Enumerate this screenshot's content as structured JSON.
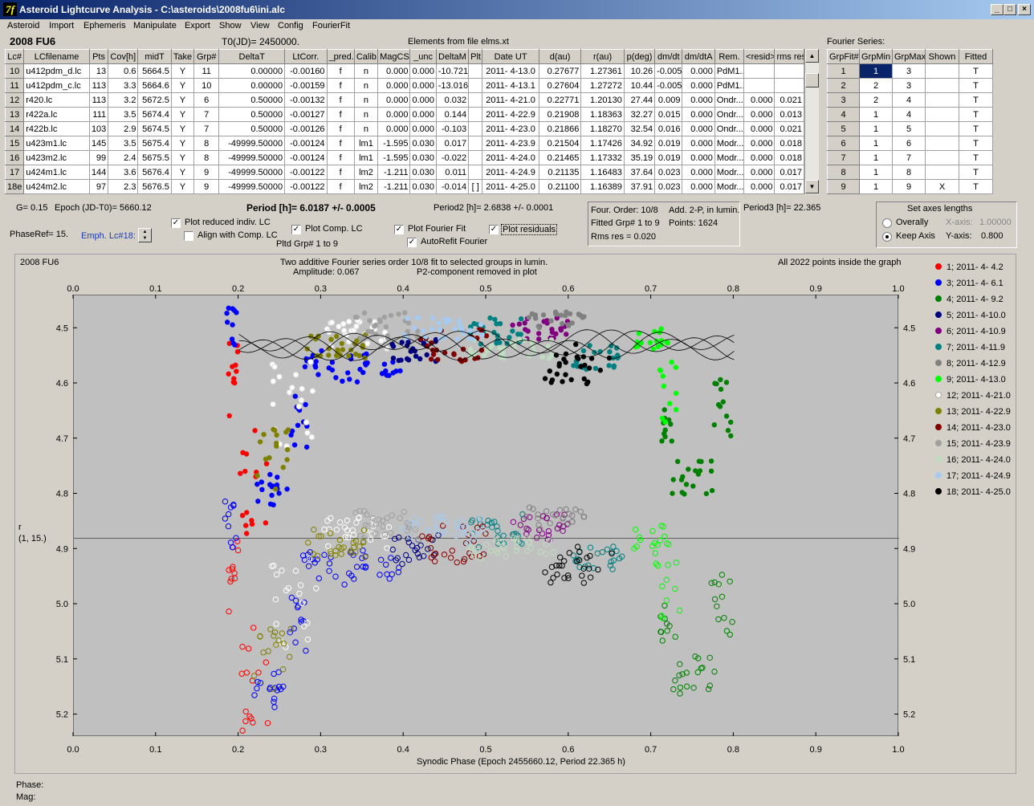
{
  "window": {
    "title": "Asteroid Lightcurve Analysis - C:\\asteroids\\2008fu6\\ini.alc",
    "icon": "7f",
    "min": "_",
    "max": "□",
    "close": "×"
  },
  "menu": [
    "Asteroid",
    "Import",
    "Ephemeris",
    "Manipulate",
    "Export",
    "Show",
    "View",
    "Config",
    "FourierFit"
  ],
  "header": {
    "object": "2008 FU6",
    "t0": "T0(JD)= 2450000.",
    "elements": "Elements from file elms.xt",
    "fourier_title": "Fourier Series:"
  },
  "lc_table": {
    "columns": [
      "Lc#",
      "LCfilename",
      "Pts",
      "Cov[h]",
      "midT",
      "Take",
      "Grp#",
      "DeltaT",
      "LtCorr.",
      "_pred.",
      "Calib.",
      "MagCS",
      "_unc",
      "DeltaM",
      "Plt",
      "Date UT",
      "d(au)",
      "r(au)",
      "p(deg)",
      "dm/dt",
      "dm/dtA",
      "Rem.",
      "<resid>",
      "rms res"
    ],
    "rows": [
      [
        "10",
        "u412pdm_d.lc",
        "13",
        "0.6",
        "5664.5",
        "Y",
        "11",
        "0.00000",
        "-0.00160",
        "f",
        "n",
        "0.000",
        "0.000",
        "-10.721",
        "",
        "2011- 4-13.0",
        "0.27677",
        "1.27361",
        "10.26",
        "-0.005",
        "0.000",
        "PdM1..",
        "",
        ""
      ],
      [
        "11",
        "u412pdm_c.lc",
        "113",
        "3.3",
        "5664.6",
        "Y",
        "10",
        "0.00000",
        "-0.00159",
        "f",
        "n",
        "0.000",
        "0.000",
        "-13.016",
        "",
        "2011- 4-13.1",
        "0.27604",
        "1.27272",
        "10.44",
        "-0.005",
        "0.000",
        "PdM1..",
        "",
        ""
      ],
      [
        "12",
        "r420.lc",
        "113",
        "3.2",
        "5672.5",
        "Y",
        "6",
        "0.50000",
        "-0.00132",
        "f",
        "n",
        "0.000",
        "0.000",
        "0.032",
        "",
        "2011- 4-21.0",
        "0.22771",
        "1.20130",
        "27.44",
        "0.009",
        "0.000",
        "Ondr...",
        "0.000",
        "0.021"
      ],
      [
        "13",
        "r422a.lc",
        "111",
        "3.5",
        "5674.4",
        "Y",
        "7",
        "0.50000",
        "-0.00127",
        "f",
        "n",
        "0.000",
        "0.000",
        "0.144",
        "",
        "2011- 4-22.9",
        "0.21908",
        "1.18363",
        "32.27",
        "0.015",
        "0.000",
        "Ondr...",
        "0.000",
        "0.013"
      ],
      [
        "14",
        "r422b.lc",
        "103",
        "2.9",
        "5674.5",
        "Y",
        "7",
        "0.50000",
        "-0.00126",
        "f",
        "n",
        "0.000",
        "0.000",
        "-0.103",
        "",
        "2011- 4-23.0",
        "0.21866",
        "1.18270",
        "32.54",
        "0.016",
        "0.000",
        "Ondr...",
        "0.000",
        "0.021"
      ],
      [
        "15",
        "u423m1.lc",
        "145",
        "3.5",
        "5675.4",
        "Y",
        "8",
        "-49999.50000",
        "-0.00124",
        "f",
        "lm1",
        "-1.595",
        "0.030",
        "0.017",
        "",
        "2011- 4-23.9",
        "0.21504",
        "1.17426",
        "34.92",
        "0.019",
        "0.000",
        "Modr...",
        "0.000",
        "0.018"
      ],
      [
        "16",
        "u423m2.lc",
        "99",
        "2.4",
        "5675.5",
        "Y",
        "8",
        "-49999.50000",
        "-0.00124",
        "f",
        "lm1",
        "-1.595",
        "0.030",
        "-0.022",
        "",
        "2011- 4-24.0",
        "0.21465",
        "1.17332",
        "35.19",
        "0.019",
        "0.000",
        "Modr...",
        "0.000",
        "0.018"
      ],
      [
        "17",
        "u424m1.lc",
        "144",
        "3.6",
        "5676.4",
        "Y",
        "9",
        "-49999.50000",
        "-0.00122",
        "f",
        "lm2",
        "-1.211",
        "0.030",
        "0.011",
        "",
        "2011- 4-24.9",
        "0.21135",
        "1.16483",
        "37.64",
        "0.023",
        "0.000",
        "Modr...",
        "0.000",
        "0.017"
      ],
      [
        "18e",
        "u424m2.lc",
        "97",
        "2.3",
        "5676.5",
        "Y",
        "9",
        "-49999.50000",
        "-0.00122",
        "f",
        "lm2",
        "-1.211",
        "0.030",
        "-0.014",
        "[ ]",
        "2011- 4-25.0",
        "0.21100",
        "1.16389",
        "37.91",
        "0.023",
        "0.000",
        "Modr...",
        "0.000",
        "0.017"
      ]
    ]
  },
  "fourier_table": {
    "columns": [
      "GrpFit#",
      "GrpMin",
      "GrpMax",
      "Shown",
      "Fitted"
    ],
    "rows": [
      [
        "1",
        "1",
        "3",
        "",
        "T"
      ],
      [
        "2",
        "2",
        "3",
        "",
        "T"
      ],
      [
        "3",
        "2",
        "4",
        "",
        "T"
      ],
      [
        "4",
        "1",
        "4",
        "",
        "T"
      ],
      [
        "5",
        "1",
        "5",
        "",
        "T"
      ],
      [
        "6",
        "1",
        "6",
        "",
        "T"
      ],
      [
        "7",
        "1",
        "7",
        "",
        "T"
      ],
      [
        "8",
        "1",
        "8",
        "",
        "T"
      ],
      [
        "9",
        "1",
        "9",
        "X",
        "T"
      ]
    ]
  },
  "controls": {
    "g": "G= 0.15",
    "epoch": "Epoch (JD-T0)= 5660.12",
    "phaseref": "PhaseRef= 15.",
    "emph": "Emph. Lc#18:",
    "plot_reduced": "Plot reduced indiv. LC",
    "align": "Align with Comp. LC",
    "plot_comp": "Plot Comp. LC",
    "pltd_grp": "Pltd Grp#  1   to   9",
    "plot_fourier": "Plot Fourier Fit",
    "autorefit": "AutoRefit Fourier",
    "plot_residuals": "Plot residuals",
    "period": "Period [h]= 6.0187 +/- 0.0005",
    "period2": "Period2 [h]= 2.6838 +/- 0.0001",
    "period3": "Period3 [h]= 22.365",
    "four_order": "Four. Order: 10/8",
    "add": "Add. 2-P, in lumin.",
    "fitted_grp": "Fitted Grp# 1 to 9",
    "points": "Points: 1624",
    "rms": "Rms res     = 0.020",
    "axes_title": "Set axes lengths",
    "overally": "Overally",
    "keep_axis": "Keep Axis",
    "xaxis_lbl": "X-axis:",
    "xaxis_val": "1.00000",
    "yaxis_lbl": "Y-axis:",
    "yaxis_val": "0.800",
    "phase_lbl": "Phase:",
    "mag_lbl": "Mag:"
  },
  "chart_data": {
    "type": "scatter",
    "object": "2008 FU6",
    "title": "Two additive Fourier series order 10/8 fit to selected groups in lumin.",
    "subtitle": "Amplitude: 0.067",
    "subtitle2": "P2-component removed in plot",
    "note": "All 2022 points inside the graph",
    "xlabel": "Synodic Phase (Epoch 2455660.12, Period 22.365 h)",
    "ylabel": "r",
    "ylabel2": "(1, 15.)",
    "xlim": [
      0.0,
      1.0
    ],
    "ylim": [
      4.44,
      5.24
    ],
    "yticks": [
      "4.5",
      "4.6",
      "4.7",
      "4.8",
      "4.9",
      "5.0",
      "5.1",
      "5.2"
    ],
    "xticks": [
      "0.0",
      "0.1",
      "0.2",
      "0.3",
      "0.4",
      "0.5",
      "0.6",
      "0.7",
      "0.8",
      "0.9",
      "1.0"
    ],
    "y_inverted": true,
    "residual_offset": 0.36,
    "ref_line": 4.88,
    "series": [
      {
        "name": "1; 2011- 4- 4.2",
        "color": "#ff0000",
        "segments": [
          [
            0.185,
            0.205,
            4.52,
            4.66
          ],
          [
            0.2,
            0.235,
            4.68,
            4.88
          ]
        ]
      },
      {
        "name": "3; 2011- 4- 6.1",
        "color": "#0000ff",
        "segments": [
          [
            0.185,
            0.2,
            4.46,
            4.54
          ],
          [
            0.22,
            0.26,
            4.76,
            4.82
          ],
          [
            0.26,
            0.285,
            4.62,
            4.72
          ],
          [
            0.28,
            0.4,
            4.54,
            4.6
          ]
        ]
      },
      {
        "name": "4; 2011- 4- 9.2",
        "color": "#008000",
        "segments": [
          [
            0.71,
            0.725,
            4.64,
            4.72
          ],
          [
            0.725,
            0.775,
            4.74,
            4.8
          ],
          [
            0.775,
            0.8,
            4.58,
            4.7
          ]
        ]
      },
      {
        "name": "5; 2011- 4-10.0",
        "color": "#000080",
        "segments": [
          [
            0.38,
            0.44,
            4.52,
            4.56
          ]
        ]
      },
      {
        "name": "6; 2011- 4-10.9",
        "color": "#800080",
        "segments": [
          [
            0.53,
            0.6,
            4.48,
            4.52
          ]
        ]
      },
      {
        "name": "7; 2011- 4-11.9",
        "color": "#008080",
        "segments": [
          [
            0.48,
            0.55,
            4.48,
            4.53
          ],
          [
            0.6,
            0.66,
            4.53,
            4.58
          ]
        ]
      },
      {
        "name": "8; 2011- 4-12.9",
        "color": "#808080",
        "segments": [
          [
            0.55,
            0.62,
            4.47,
            4.5
          ]
        ]
      },
      {
        "name": "9; 2011- 4-13.0",
        "color": "#00ff00",
        "segments": [
          [
            0.68,
            0.72,
            4.5,
            4.54
          ],
          [
            0.71,
            0.73,
            4.55,
            4.68
          ]
        ]
      },
      {
        "name": "12; 2011- 4-21.0",
        "color": "#ffffff",
        "segments": [
          [
            0.24,
            0.29,
            4.56,
            4.72
          ],
          [
            0.3,
            0.38,
            4.48,
            4.54
          ]
        ]
      },
      {
        "name": "13; 2011- 4-22.9",
        "color": "#808000",
        "segments": [
          [
            0.22,
            0.26,
            4.68,
            4.8
          ],
          [
            0.28,
            0.36,
            4.51,
            4.56
          ]
        ]
      },
      {
        "name": "14; 2011- 4-23.0",
        "color": "#800000",
        "segments": [
          [
            0.42,
            0.5,
            4.5,
            4.56
          ]
        ]
      },
      {
        "name": "15; 2011- 4-23.9",
        "color": "#a0a0a0",
        "segments": [
          [
            0.34,
            0.42,
            4.47,
            4.52
          ]
        ]
      },
      {
        "name": "16; 2011- 4-24.0",
        "color": "#c0dcc0",
        "segments": [
          [
            0.48,
            0.58,
            4.52,
            4.56
          ]
        ]
      },
      {
        "name": "17; 2011- 4-24.9",
        "color": "#a6caf0",
        "segments": [
          [
            0.4,
            0.5,
            4.48,
            4.52
          ]
        ]
      },
      {
        "name": "18; 2011- 4-25.0",
        "color": "#000000",
        "segments": [
          [
            0.57,
            0.65,
            4.52,
            4.6
          ]
        ]
      }
    ]
  }
}
